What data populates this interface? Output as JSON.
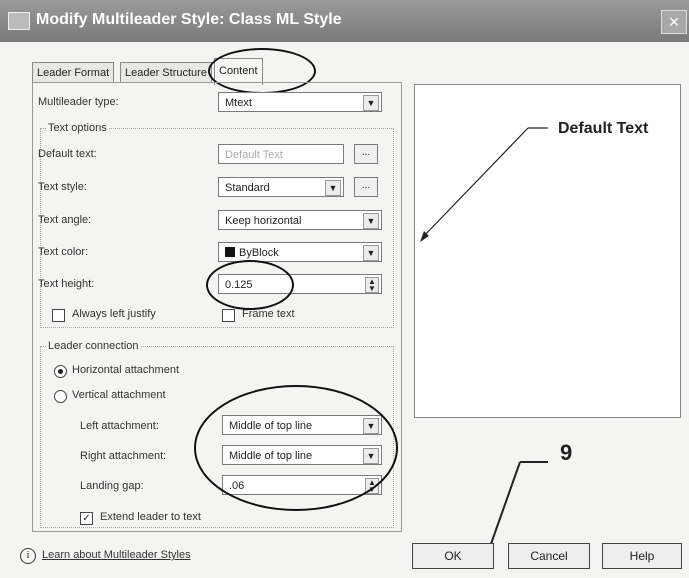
{
  "window": {
    "title": "Modify Multileader Style: Class ML Style"
  },
  "tabs": [
    {
      "label": "Leader Format"
    },
    {
      "label": "Leader Structure"
    },
    {
      "label": "Content"
    }
  ],
  "content": {
    "multileader_type": {
      "label": "Multileader type:",
      "value": "Mtext"
    },
    "text_options": {
      "group_label": "Text options",
      "default_text": {
        "label": "Default text:",
        "value": "Default Text"
      },
      "text_style": {
        "label": "Text style:",
        "value": "Standard"
      },
      "text_angle": {
        "label": "Text angle:",
        "value": "Keep horizontal"
      },
      "text_color": {
        "label": "Text color:",
        "value": "ByBlock"
      },
      "text_height": {
        "label": "Text height:",
        "value": "0.125"
      },
      "always_left_justify": {
        "label": "Always left justify",
        "checked": false
      },
      "frame_text": {
        "label": "Frame text",
        "checked": false
      }
    },
    "leader_connection": {
      "group_label": "Leader connection",
      "horizontal": {
        "label": "Horizontal attachment",
        "selected": true
      },
      "vertical": {
        "label": "Vertical attachment",
        "selected": false
      },
      "left_attachment": {
        "label": "Left attachment:",
        "value": "Middle of top line"
      },
      "right_attachment": {
        "label": "Right attachment:",
        "value": "Middle of top line"
      },
      "landing_gap": {
        "label": "Landing gap:",
        "value": ".06"
      },
      "extend_leader": {
        "label": "Extend leader to text",
        "checked": true
      }
    }
  },
  "footer": {
    "learn_link": "Learn about Multileader Styles",
    "ok": "OK",
    "cancel": "Cancel",
    "help": "Help"
  },
  "annotations": {
    "default_text_callout": "Default Text",
    "step_number": "9"
  }
}
